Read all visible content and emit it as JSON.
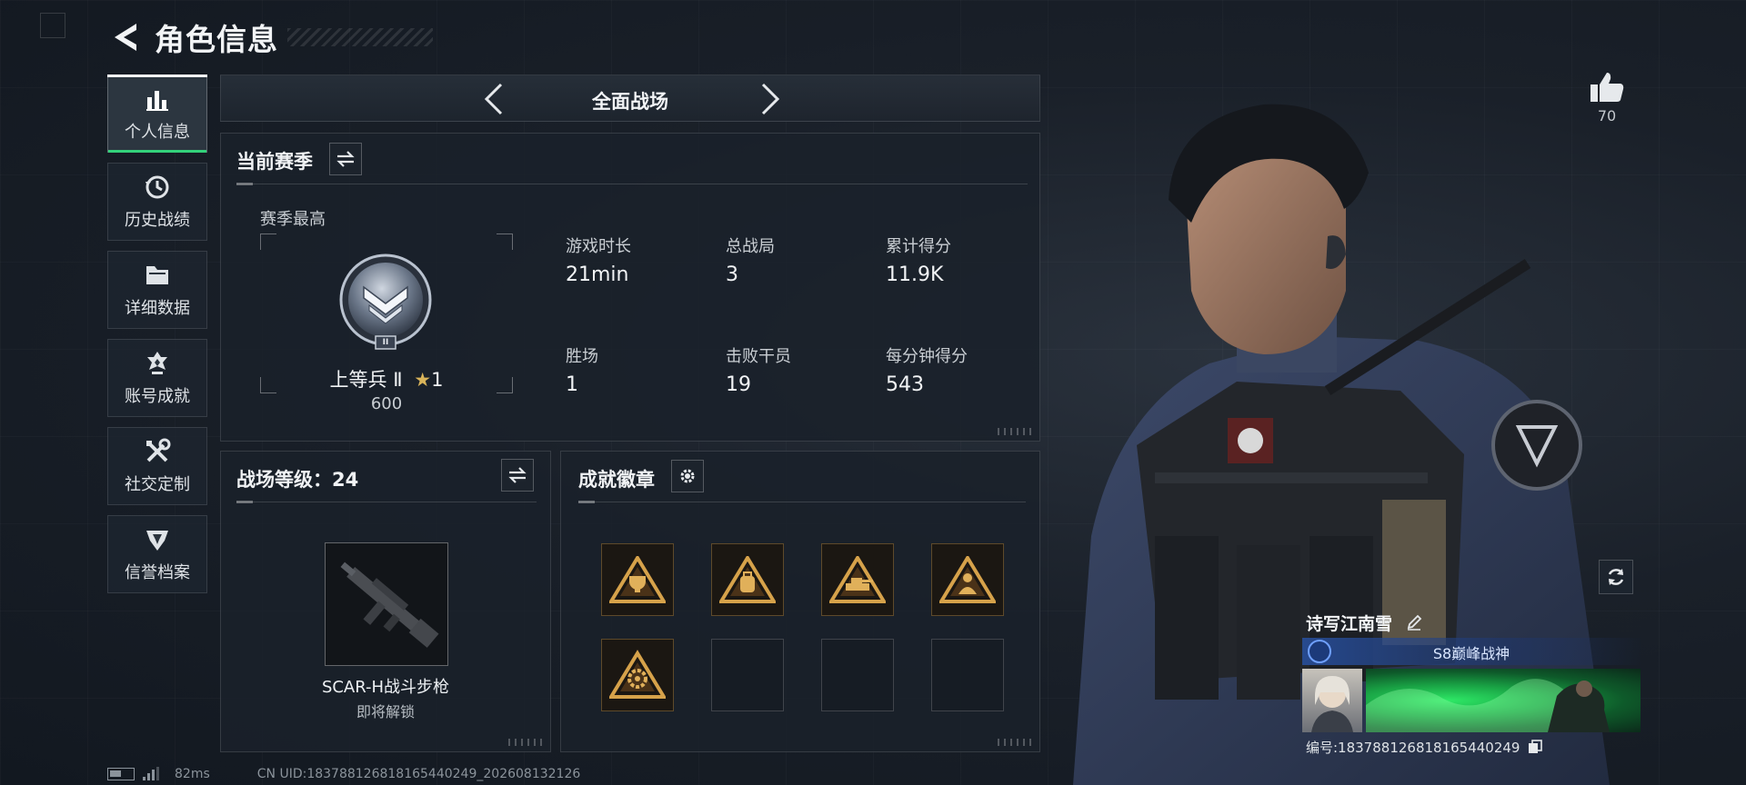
{
  "header": {
    "title": "角色信息"
  },
  "sidebar": {
    "items": [
      {
        "label": "个人信息",
        "icon": "bar-chart-icon",
        "active": true
      },
      {
        "label": "历史战绩",
        "icon": "history-clock-icon"
      },
      {
        "label": "详细数据",
        "icon": "folder-icon"
      },
      {
        "label": "账号成就",
        "icon": "achievement-icon"
      },
      {
        "label": "社交定制",
        "icon": "wrench-icon"
      },
      {
        "label": "信誉档案",
        "icon": "credit-emblem-icon"
      }
    ]
  },
  "mode": {
    "label": "全面战场"
  },
  "season": {
    "title": "当前赛季",
    "best_label": "赛季最高",
    "rank_name": "上等兵 Ⅱ",
    "rank_stars": "1",
    "rank_points": "600",
    "rank_numeral": "II",
    "stats": [
      {
        "label": "游戏时长",
        "value": "21min"
      },
      {
        "label": "总战局",
        "value": "3"
      },
      {
        "label": "累计得分",
        "value": "11.9K"
      },
      {
        "label": "胜场",
        "value": "1"
      },
      {
        "label": "击败干员",
        "value": "19"
      },
      {
        "label": "每分钟得分",
        "value": "543"
      }
    ]
  },
  "battle_level": {
    "title": "战场等级：24",
    "weapon_name": "SCAR-H战斗步枪",
    "weapon_status": "即将解锁"
  },
  "badges": {
    "title": "成就徽章",
    "filled_count": 5,
    "total_slots": 8
  },
  "like": {
    "count": "70"
  },
  "player": {
    "name": "诗写江南雪",
    "title": "S8巅峰战神",
    "id_text": "编号:1837881268181654402​49"
  },
  "footer": {
    "ping": "82ms",
    "uid": "CN UID:1837881268181654402​49_202608132126"
  },
  "colors": {
    "accent_green": "#33d17a",
    "badge_gold": "#d6a24a",
    "title_blue": "#2f5fb8"
  }
}
